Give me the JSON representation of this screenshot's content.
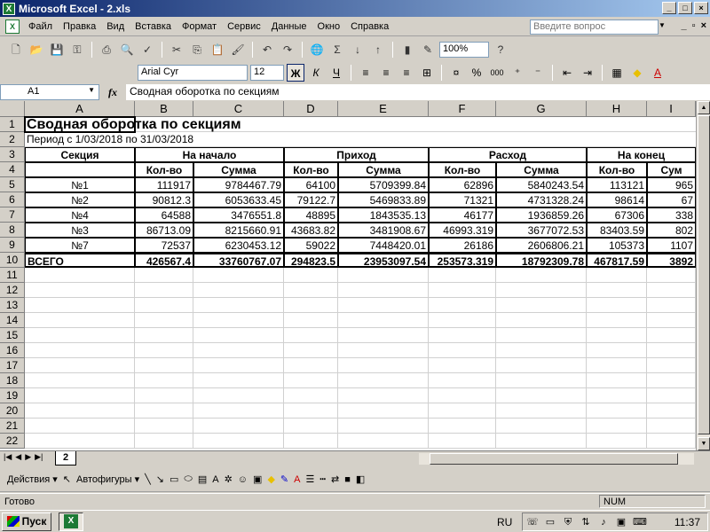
{
  "window": {
    "title": "Microsoft Excel - 2.xls",
    "buttons": {
      "minimize": "_",
      "maximize": "□",
      "close": "×"
    }
  },
  "menu": {
    "items": [
      "Файл",
      "Правка",
      "Вид",
      "Вставка",
      "Формат",
      "Сервис",
      "Данные",
      "Окно",
      "Справка"
    ],
    "help_placeholder": "Введите вопрос",
    "doc_buttons": {
      "minimize": "_",
      "restore": "▫",
      "close": "×"
    }
  },
  "toolbar": {
    "zoom": "100%",
    "font_name": "Arial Cyr",
    "font_size": "12",
    "bold": "Ж",
    "italic": "К",
    "underline": "Ч",
    "sigma": "Σ",
    "percent": "%",
    "thousands": "000"
  },
  "formula_bar": {
    "name_box": "A1",
    "fx": "fx",
    "content": "Сводная оборотка по секциям"
  },
  "columns": [
    "A",
    "B",
    "C",
    "D",
    "E",
    "F",
    "G",
    "H",
    "I"
  ],
  "rows": [
    "1",
    "2",
    "3",
    "4",
    "5",
    "6",
    "7",
    "8",
    "9",
    "10",
    "11",
    "12",
    "13",
    "14",
    "15",
    "16",
    "17",
    "18",
    "19",
    "20",
    "21",
    "22"
  ],
  "sheet": {
    "title": "Сводная оборотка по секциям",
    "period": "Период с   1/03/2018 по 31/03/2018",
    "group_headers": {
      "section": "Секция",
      "start": "На начало",
      "income": "Приход",
      "expense": "Расход",
      "end": "На конец"
    },
    "sub_headers": {
      "qty": "Кол-во",
      "sum": "Сумма",
      "sum_partial": "Сум"
    },
    "data": [
      [
        "№1",
        "111917",
        "9784467.79",
        "64100",
        "5709399.84",
        "62896",
        "5840243.54",
        "113121",
        "965"
      ],
      [
        "№2",
        "90812.3",
        "6053633.45",
        "79122.7",
        "5469833.89",
        "71321",
        "4731328.24",
        "98614",
        "67"
      ],
      [
        "№4",
        "64588",
        "3476551.8",
        "48895",
        "1843535.13",
        "46177",
        "1936859.26",
        "67306",
        "338"
      ],
      [
        "№3",
        "86713.09",
        "8215660.91",
        "43683.82",
        "3481908.67",
        "46993.319",
        "3677072.53",
        "83403.59",
        "802"
      ],
      [
        "№7",
        "72537",
        "6230453.12",
        "59022",
        "7448420.01",
        "26186",
        "2606806.21",
        "105373",
        "1107"
      ]
    ],
    "total": [
      "ВСЕГО",
      "426567.4",
      "33760767.07",
      "294823.5",
      "23953097.54",
      "253573.319",
      "18792309.78",
      "467817.59",
      "3892"
    ]
  },
  "tabs": {
    "active": "2"
  },
  "drawing": {
    "actions": "Действия",
    "autoshapes": "Автофигуры"
  },
  "status": {
    "ready": "Готово",
    "num": "NUM"
  },
  "taskbar": {
    "start": "Пуск",
    "lang": "RU",
    "clock": "11:37"
  }
}
